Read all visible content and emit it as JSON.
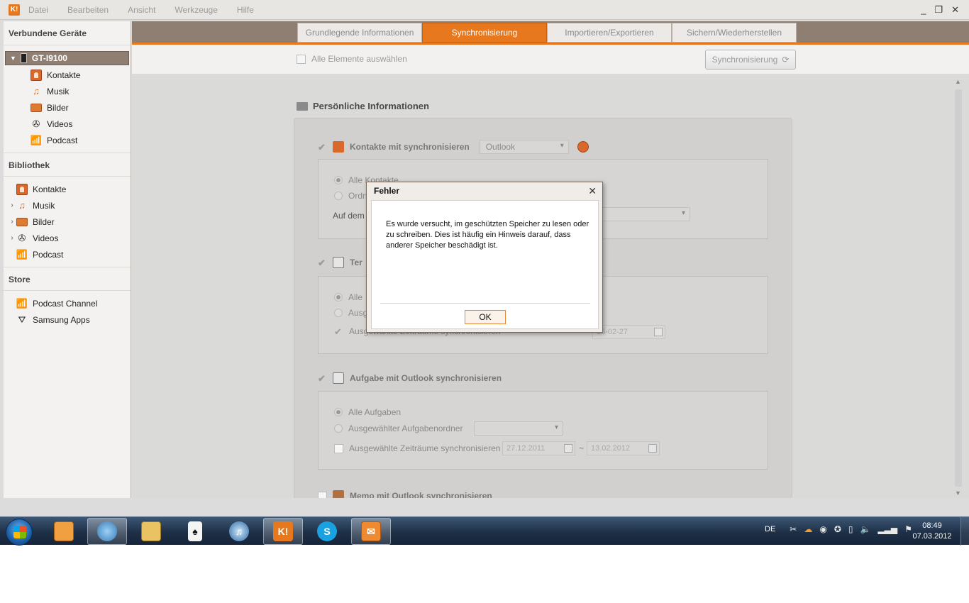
{
  "menubar": {
    "logo": "K!",
    "items": [
      "Datei",
      "Bearbeiten",
      "Ansicht",
      "Werkzeuge",
      "Hilfe"
    ],
    "window_controls": [
      "_",
      "❐",
      "✕"
    ]
  },
  "sidebar": {
    "connected_title": "Verbundene Geräte",
    "device": "GT-I9100",
    "device_items": [
      "Kontakte",
      "Musik",
      "Bilder",
      "Videos",
      "Podcast"
    ],
    "library_title": "Bibliothek",
    "library_items": [
      "Kontakte",
      "Musik",
      "Bilder",
      "Videos",
      "Podcast"
    ],
    "store_title": "Store",
    "store_items": [
      "Podcast Channel",
      "Samsung Apps"
    ]
  },
  "tabs": [
    "Grundlegende Informationen",
    "Synchronisierung",
    "Importieren/Exportieren",
    "Sichern/Wiederherstellen"
  ],
  "active_tab": "Synchronisierung",
  "toolbar": {
    "select_all": "Alle Elemente auswählen",
    "sync_button": "Synchronisierung"
  },
  "section": {
    "title": "Persönliche Informationen",
    "contacts": {
      "label": "Kontakte mit synchronisieren",
      "dropdown": "Outlook",
      "opt_all": "Alle Kontakte",
      "opt_folder": "Ordn",
      "target_label": "Auf dem"
    },
    "calendar": {
      "label": "Ter",
      "opt_all": "Alle",
      "opt_selected": "Ausg",
      "periods_label": "Ausgewählte Zeiträume synchronisieren",
      "date_to": "15-02-27"
    },
    "tasks": {
      "label": "Aufgabe mit Outlook synchronisieren",
      "opt_all": "Alle Aufgaben",
      "opt_folder": "Ausgewählter Aufgabenordner",
      "periods_label": "Ausgewählte Zeiträume synchronisieren",
      "date_from": "27.12.2011",
      "date_to": "13.02.2012",
      "range_sep": "~"
    },
    "memo": {
      "label": "Memo mit Outlook synchronisieren"
    }
  },
  "dialog": {
    "title": "Fehler",
    "close": "✕",
    "message": "Es wurde versucht, im geschützten Speicher zu lesen oder zu schreiben. Dies ist häufig ein Hinweis darauf, dass anderer Speicher beschädigt ist.",
    "ok": "OK"
  },
  "taskbar": {
    "language": "DE",
    "time": "08:49",
    "date": "07.03.2012"
  },
  "colors": {
    "accent": "#e8781e",
    "header_brown": "#8f7f72"
  }
}
